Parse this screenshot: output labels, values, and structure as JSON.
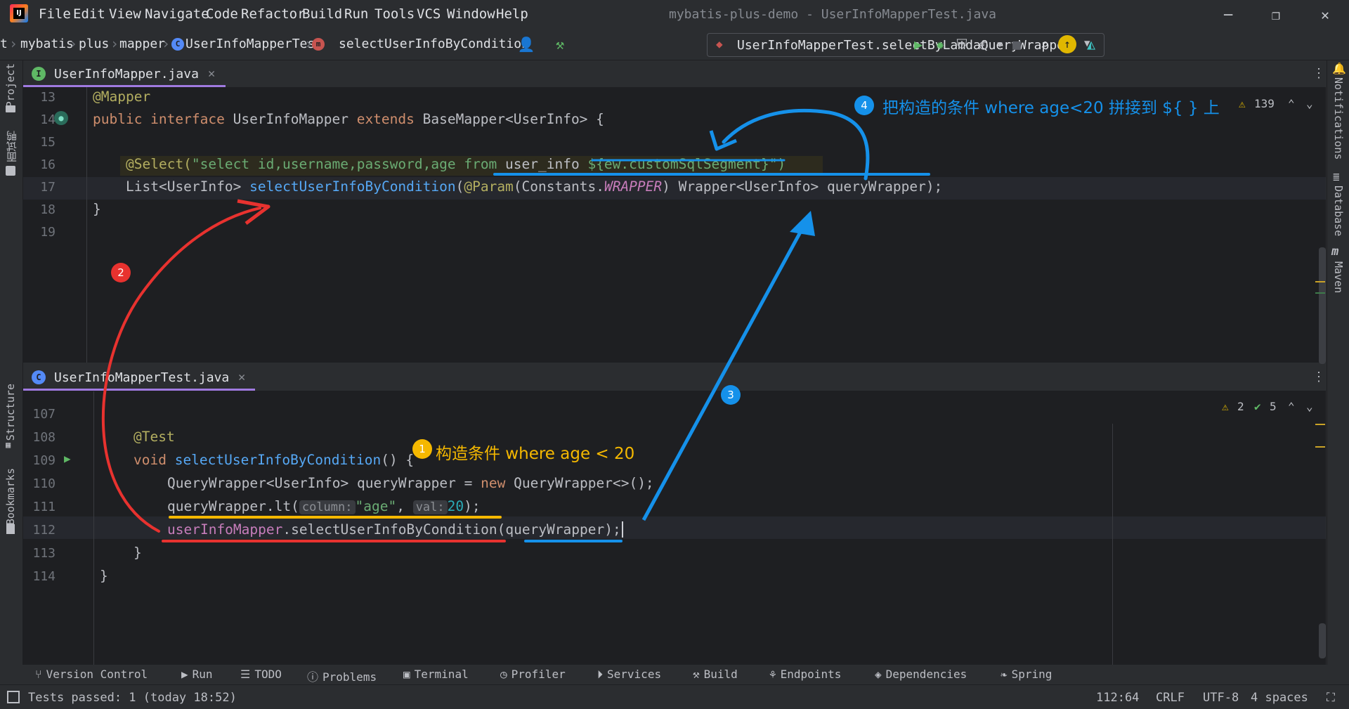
{
  "menubar": {
    "items": [
      "File",
      "Edit",
      "View",
      "Navigate",
      "Code",
      "Refactor",
      "Build",
      "Run",
      "Tools",
      "VCS",
      "Window",
      "Help"
    ],
    "window_title": "mybatis-plus-demo - UserInfoMapperTest.java"
  },
  "navbar": {
    "breadcrumbs": [
      "t",
      "mybatis",
      "plus",
      "mapper",
      "UserInfoMapperTest",
      "selectUserInfoByCondition"
    ],
    "run_config": "UserInfoMapperTest.selectByLamdaQueryWrapper"
  },
  "left_strip": {
    "project": "Project",
    "interview": "面试鸭",
    "structure": "Structure",
    "bookmarks": "Bookmarks"
  },
  "right_strip": {
    "notifications": "Notifications",
    "database": "Database",
    "maven": "Maven"
  },
  "top_editor": {
    "tab": "UserInfoMapper.java",
    "warnings": "139",
    "lines": [
      "13",
      "14",
      "15",
      "16",
      "17",
      "18",
      "19"
    ],
    "code": {
      "l13": "@Mapper",
      "l14_kw1": "public interface ",
      "l14_name": "UserInfoMapper ",
      "l14_kw2": "extends ",
      "l14_rest": "BaseMapper<UserInfo> {",
      "l16_ann": "@Select(",
      "l16_str1": "\"select id,username,password,age from ",
      "l16_table": "user_info ",
      "l16_seg": "${ew.customSqlSegment}",
      "l16_end": "\")",
      "l17_type": "List<UserInfo> ",
      "l17_method": "selectUserInfoByCondition",
      "l17_paren": "(",
      "l17_param_ann": "@Param",
      "l17_args1": "(Constants.",
      "l17_wrapper": "WRAPPER",
      "l17_args2": ") Wrapper<UserInfo> queryWrapper);",
      "l18": "}"
    }
  },
  "bottom_editor": {
    "tab": "UserInfoMapperTest.java",
    "warnings": "2",
    "checks": "5",
    "lines": [
      "107",
      "108",
      "109",
      "110",
      "111",
      "112",
      "113",
      "114"
    ],
    "code": {
      "l108": "@Test",
      "l109_kw": "void ",
      "l109_name": "selectUserInfoByCondition",
      "l109_rest": "() {",
      "l110_a": "QueryWrapper<UserInfo> queryWrapper = ",
      "l110_new": "new ",
      "l110_b": "QueryWrapper<>();",
      "l111_a": "queryWrapper.lt(",
      "l111_hint1": "column:",
      "l111_str": "\"age\"",
      "l111_comma": ", ",
      "l111_hint2": "val:",
      "l111_num": "20",
      "l111_end": ");",
      "l112_field": "userInfoMapper",
      "l112_rest": ".selectUserInfoByCondition(queryWrapper);",
      "l113": "}",
      "l114": "}"
    }
  },
  "annotations": {
    "n1": "1",
    "t1": "构造条件 where age < 20",
    "n2": "2",
    "n3": "3",
    "n4": "4",
    "t4": "把构造的条件 where age<20 拼接到 ${ } 上"
  },
  "toolwindows": [
    "Version Control",
    "Run",
    "TODO",
    "Problems",
    "Terminal",
    "Profiler",
    "Services",
    "Build",
    "Endpoints",
    "Dependencies",
    "Spring"
  ],
  "status": {
    "message": "Tests passed: 1 (today 18:52)",
    "position": "112:64",
    "line_sep": "CRLF",
    "encoding": "UTF-8",
    "indent": "4 spaces"
  },
  "colors": {
    "annot_yellow": "#f5b800",
    "annot_red": "#e8322f",
    "annot_blue": "#1591ea",
    "tab_accent": "#a07ae0"
  }
}
